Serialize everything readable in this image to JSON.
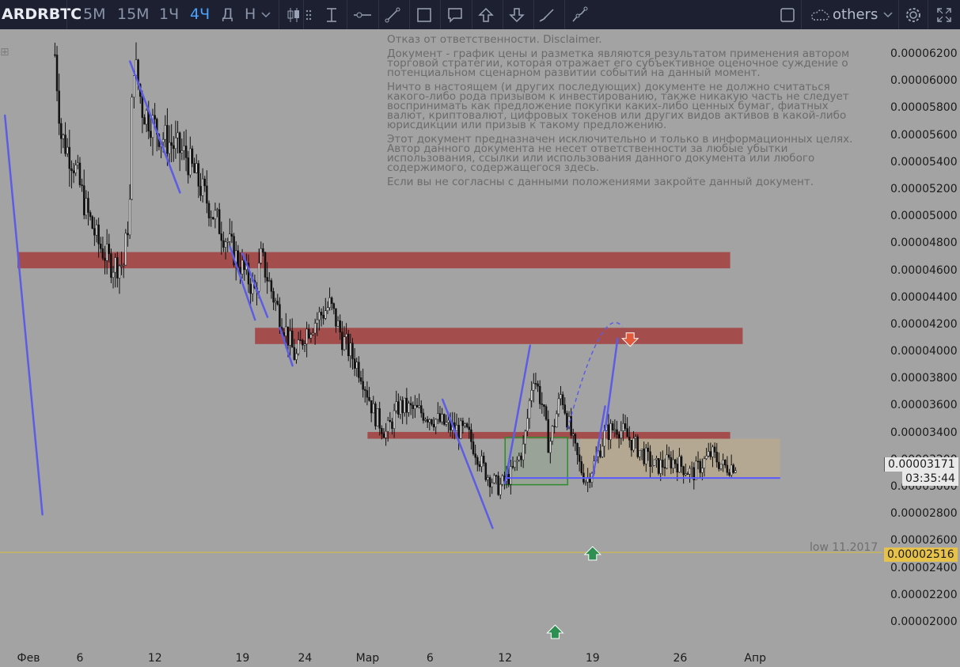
{
  "toolbar": {
    "symbol": "ARDRBTC",
    "timeframes": [
      "5М",
      "15М",
      "1Ч",
      "4Ч",
      "Д",
      "Н"
    ],
    "active_timeframe": "4Ч",
    "layout_label": "others",
    "accent_color": "#4aa3ff"
  },
  "disclaimer": [
    "Отказ от ответственности. Disclaimer.",
    "Документ - график цены и разметка являются результатом применения автором торговой стратегии, которая отражает его субъективное оценочное суждение о потенциальном сценарном развитии событий на данный момент.",
    "Ничто в настоящем (и других последующих) документе не должно считаться какого-либо рода призывом к инвестированию, также никакую часть не следует воспринимать как предложение покупки каких-либо ценных бумаг, фиатных валют, криптовалют, цифровых токенов или других видов активов в какой-либо юрисдикции или призыв к такому предложению.",
    "Этот документ предназначен исключительно и только в информационных целях. Автор данного документа не несет ответственности за любые убытки использования, ссылки или использования данного документа или любого содержимого, содержащегося здесь.",
    "Если вы не согласны с данными положениями закройте данный документ."
  ],
  "price_labels": {
    "current_price": "0.00003171",
    "countdown": "03:35:44",
    "low_label": "low 11.2017",
    "low_price": "0.00002516"
  },
  "chart_data": {
    "type": "candlestick",
    "title": "",
    "y_axis_ticks": [
      "0.00006200",
      "0.00006000",
      "0.00005800",
      "0.00005600",
      "0.00005400",
      "0.00005200",
      "0.00005000",
      "0.00004800",
      "0.00004600",
      "0.00004400",
      "0.00004200",
      "0.00004000",
      "0.00003800",
      "0.00003600",
      "0.00003400",
      "0.00003200",
      "0.00003000",
      "0.00002800",
      "0.00002600",
      "0.00002400",
      "0.00002200",
      "0.00002000"
    ],
    "ylim": [
      1.79e-05,
      6.36e-05
    ],
    "x_axis_ticks": [
      "Фев",
      "6",
      "12",
      "19",
      "24",
      "Мар",
      "6",
      "12",
      "19",
      "26",
      "Апр"
    ],
    "x_range": [
      "2018-02-01",
      "2018-04-04"
    ],
    "close_path": [
      [
        "2018-02-04T00",
        6.2e-05
      ],
      [
        "2018-02-04T12",
        5.6e-05
      ],
      [
        "2018-02-05T12",
        5.4e-05
      ],
      [
        "2018-02-06T12",
        5.05e-05
      ],
      [
        "2018-02-07T12",
        4.8e-05
      ],
      [
        "2018-02-08T12",
        4.65e-05
      ],
      [
        "2018-02-09T12",
        4.65e-05
      ],
      [
        "2018-02-10T00",
        5.1e-05
      ],
      [
        "2018-02-10T06",
        6.2e-05
      ],
      [
        "2018-02-11T00",
        5.8e-05
      ],
      [
        "2018-02-12T12",
        5.6e-05
      ],
      [
        "2018-02-14T12",
        5.45e-05
      ],
      [
        "2018-02-16T12",
        5.05e-05
      ],
      [
        "2018-02-18T12",
        4.7e-05
      ],
      [
        "2018-02-20T00",
        4.45e-05
      ],
      [
        "2018-02-20T12",
        4.7e-05
      ],
      [
        "2018-02-21T12",
        4.4e-05
      ],
      [
        "2018-02-22T12",
        4.15e-05
      ],
      [
        "2018-02-23T06",
        3.95e-05
      ],
      [
        "2018-02-24T00",
        4.15e-05
      ],
      [
        "2018-02-26T00",
        4.35e-05
      ],
      [
        "2018-02-27T00",
        4.1e-05
      ],
      [
        "2018-02-28T12",
        3.85e-05
      ],
      [
        "2018-03-01T12",
        3.55e-05
      ],
      [
        "2018-03-02T12",
        3.4e-05
      ],
      [
        "2018-03-03T12",
        3.6e-05
      ],
      [
        "2018-03-05T12",
        3.55e-05
      ],
      [
        "2018-03-07T12",
        3.45e-05
      ],
      [
        "2018-03-09T00",
        3.4e-05
      ],
      [
        "2018-03-10T12",
        3.1e-05
      ],
      [
        "2018-03-11T12",
        3e-05
      ],
      [
        "2018-03-12T12",
        3.1e-05
      ],
      [
        "2018-03-13T12",
        3.3e-05
      ],
      [
        "2018-03-14T06",
        3.85e-05
      ],
      [
        "2018-03-15T00",
        3.6e-05
      ],
      [
        "2018-03-15T12",
        3.3e-05
      ],
      [
        "2018-03-16T12",
        3.7e-05
      ],
      [
        "2018-03-17T12",
        3.3e-05
      ],
      [
        "2018-03-18T00",
        3.15e-05
      ],
      [
        "2018-03-18T12",
        3.05e-05
      ],
      [
        "2018-03-19T06",
        3.2e-05
      ],
      [
        "2018-03-20T00",
        3.4e-05
      ],
      [
        "2018-03-21T00",
        3.45e-05
      ],
      [
        "2018-03-22T12",
        3.3e-05
      ],
      [
        "2018-03-24T00",
        3.15e-05
      ],
      [
        "2018-03-25T12",
        3.2e-05
      ],
      [
        "2018-03-27T00",
        3.1e-05
      ],
      [
        "2018-03-28T12",
        3.25e-05
      ],
      [
        "2018-03-29T12",
        3.15e-05
      ],
      [
        "2018-03-30T12",
        3.17e-05
      ]
    ],
    "resistance_zones": [
      {
        "price_range": [
          4.62e-05,
          4.74e-05
        ],
        "x": [
          "2018-02-01",
          "2018-03-30"
        ],
        "color": "#a33e3e"
      },
      {
        "price_range": [
          4.06e-05,
          4.18e-05
        ],
        "x": [
          "2018-02-20",
          "2018-03-31"
        ],
        "color": "#a33e3e"
      },
      {
        "price_range": [
          3.36e-05,
          3.41e-05
        ],
        "x": [
          "2018-03-01",
          "2018-03-30"
        ],
        "color": "#a33e3e"
      }
    ],
    "range_box": {
      "price_range": [
        3.07e-05,
        3.36e-05
      ],
      "x": [
        "2018-03-18",
        "2018-04-03"
      ],
      "color": "#b9a98c"
    },
    "consolidation_box": {
      "price_range": [
        3.02e-05,
        3.37e-05
      ],
      "x": [
        "2018-03-12",
        "2018-03-17"
      ],
      "color": "#2e8b2e"
    },
    "horizontal_lines": [
      {
        "price": 2.52e-05,
        "color": "#d9c03a"
      },
      {
        "price": 3.07e-05,
        "x": [
          "2018-03-12",
          "2018-04-03"
        ],
        "color": "#5a5aff"
      }
    ],
    "trend_lines": [
      {
        "points": [
          [
            "2018-01-31",
            5.75e-05
          ],
          [
            "2018-02-03",
            2.8e-05
          ]
        ]
      },
      {
        "points": [
          [
            "2018-02-10",
            6.15e-05
          ],
          [
            "2018-02-14",
            5.18e-05
          ]
        ]
      },
      {
        "points": [
          [
            "2018-02-18",
            4.78e-05
          ],
          [
            "2018-02-20",
            4.24e-05
          ]
        ]
      },
      {
        "points": [
          [
            "2018-02-19",
            4.73e-05
          ],
          [
            "2018-02-21",
            4.26e-05
          ]
        ]
      },
      {
        "points": [
          [
            "2018-02-22",
            4.18e-05
          ],
          [
            "2018-02-23",
            3.9e-05
          ]
        ]
      },
      {
        "points": [
          [
            "2018-03-07",
            3.65e-05
          ],
          [
            "2018-03-11",
            2.7e-05
          ]
        ]
      },
      {
        "points": [
          [
            "2018-03-12",
            3.03e-05
          ],
          [
            "2018-03-14",
            4.05e-05
          ]
        ]
      },
      {
        "points": [
          [
            "2018-03-19",
            3.07e-05
          ],
          [
            "2018-03-20",
            3.6e-05
          ]
        ]
      },
      {
        "points": [
          [
            "2018-03-20",
            3.42e-05
          ],
          [
            "2018-03-21",
            4.1e-05
          ]
        ]
      }
    ],
    "projection_arc": {
      "from": [
        "2018-03-17",
        3.43e-05
      ],
      "peak": [
        "2018-03-21",
        4.2e-05
      ]
    },
    "arrows": [
      {
        "direction": "down",
        "x": "2018-03-22",
        "price": 4.09e-05,
        "color": "#e25a3c"
      },
      {
        "direction": "up",
        "x": "2018-03-19",
        "price": 2.51e-05,
        "color": "#2f8f52"
      },
      {
        "direction": "up",
        "x": "2018-03-16",
        "price": 1.93e-05,
        "color": "#2f8f52"
      }
    ]
  }
}
